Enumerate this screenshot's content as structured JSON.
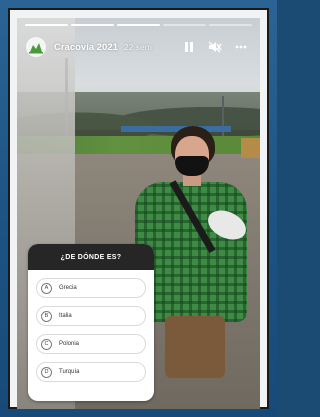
{
  "story": {
    "progress_segments": 5,
    "progress_done": 3,
    "account_name": "Cracovia 2021",
    "time_ago": "22 sem",
    "controls": [
      "pause-icon",
      "mute-icon",
      "more-icon"
    ]
  },
  "quiz": {
    "question": "¿DE DÓNDE ES?",
    "options": [
      {
        "letter": "A",
        "text": "Grecia"
      },
      {
        "letter": "B",
        "text": "Italia"
      },
      {
        "letter": "C",
        "text": "Polonia"
      },
      {
        "letter": "D",
        "text": "Turquía"
      }
    ]
  },
  "colors": {
    "frame_blue": "#1d5484",
    "quiz_header": "#262626",
    "brand_green": "#4a9a3c"
  }
}
